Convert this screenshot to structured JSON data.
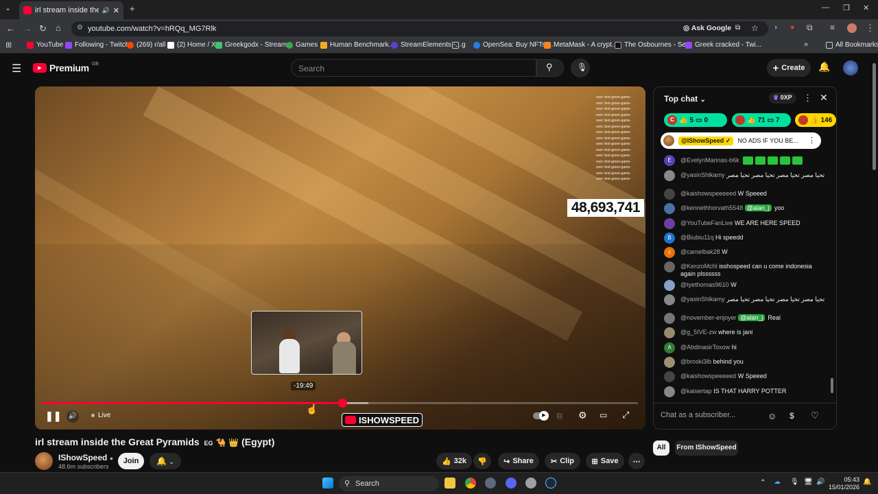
{
  "browser": {
    "tab_title": "irl stream inside the Great P",
    "url": "youtube.com/watch?v=hRQq_MG7Rlk",
    "ask_google": "Ask Google",
    "bookmarks": [
      "YouTube",
      "Following - Twitch",
      "(269) r/all",
      "(2) Home / X",
      "Greekgodx - Stream...",
      "Games",
      "Human Benchmark...",
      "StreamElements -...",
      "g",
      "OpenSea: Buy NFTs,...",
      "MetaMask - A crypt...",
      "The Osbournes - Se...",
      "Greek cracked - Twi..."
    ],
    "all_bookmarks": "All Bookmarks"
  },
  "header": {
    "logo_text": "Premium",
    "logo_region": "GB",
    "search_placeholder": "Search",
    "create_label": "Create"
  },
  "video": {
    "viewer_counter": "48,693,741",
    "preview_time": "-19:49",
    "live_label": "Live",
    "brand_text": "ISHOWSPEED",
    "overlay_lines": [
      "over::text-green-game-",
      "over::text-green-game-",
      "over::text-green-game-",
      "over::text-green-game-",
      "over::text-green-game-",
      "over::text-green-game-",
      "over::text-green-game-",
      "over::text-green-game-",
      "over::text-green-game-",
      "over::text-green-game-",
      "over::text-green-game-",
      "over::text-green-game-",
      "over::text-green-game-",
      "over::text-green-game-",
      "over::text-green-game-"
    ],
    "progress_played": 0.505,
    "progress_loaded": 0.548
  },
  "below": {
    "title": "irl stream inside the Great Pyramids",
    "title_flag": "EG",
    "title_suffix": "(Egypt)",
    "channel_name": "IShowSpeed",
    "subscribers": "48.6m subscribers",
    "join_label": "Join",
    "likes": "32k",
    "share_label": "Share",
    "clip_label": "Clip",
    "save_label": "Save"
  },
  "chat": {
    "title": "Top chat",
    "xp": "0XP",
    "polls": [
      {
        "letter": "C",
        "likes": "5",
        "comments": "0",
        "color": "#00e0a0"
      },
      {
        "letter": "",
        "likes": "71",
        "comments": "7",
        "color": "#00e0a0"
      },
      {
        "letter": "",
        "likes": "146",
        "comments": "",
        "color": "#ffd600"
      }
    ],
    "pinned_author": "@IShowSpeed",
    "pinned_text": "NO ADS IF YOU BE...",
    "messages": [
      {
        "author": "@EvelynMarinas-b6k",
        "text": "",
        "mention": "",
        "avatar": "E",
        "color": "#5c3fb5",
        "emotes": 5
      },
      {
        "author": "@yasinShlkamy",
        "text": "تحيا مصر تحيا مصر تحيا مصر تحيا مصر",
        "mention": "",
        "avatar": "",
        "color": "#888",
        "emotes": 0
      },
      {
        "author": "@kaishowspeeeeed",
        "text": "W Speeed",
        "mention": "",
        "avatar": "",
        "color": "#444",
        "emotes": 0
      },
      {
        "author": "@kennethhorvath5548",
        "text": "yoo",
        "mention": "@alan_j",
        "avatar": "",
        "color": "#4a6fa5",
        "emotes": 0
      },
      {
        "author": "@YouTubeFanLive",
        "text": "WE ARE HERE SPEED",
        "mention": "",
        "avatar": "",
        "color": "#6b3fa0",
        "emotes": 0
      },
      {
        "author": "@Biubiu11q",
        "text": "Hi speedd",
        "mention": "",
        "avatar": "B",
        "color": "#1976d2",
        "emotes": 0
      },
      {
        "author": "@camelbak28",
        "text": "W",
        "mention": "",
        "avatar": "c",
        "color": "#e8710a",
        "emotes": 0
      },
      {
        "author": "@KenzoMchl",
        "text": "isshospeed can u come indonesia again plssssss",
        "mention": "",
        "avatar": "",
        "color": "#666",
        "emotes": 0
      },
      {
        "author": "@tyethomas9610",
        "text": "W",
        "mention": "",
        "avatar": "",
        "color": "#8aa0c8",
        "emotes": 0
      },
      {
        "author": "@yasinShlkamy",
        "text": "تحيا مصر تحيا مصر تحيا مصر تحيا مصر",
        "mention": "",
        "avatar": "",
        "color": "#888",
        "emotes": 0
      },
      {
        "author": "@november-enjoyer",
        "text": "Real",
        "mention": "@alan_j",
        "avatar": "",
        "color": "#777",
        "emotes": 0
      },
      {
        "author": "@g_5IVE-zw",
        "text": "where is jani",
        "mention": "",
        "avatar": "",
        "color": "#9a8a70",
        "emotes": 0
      },
      {
        "author": "@AbdinasirToxow",
        "text": "hi",
        "mention": "",
        "avatar": "A",
        "color": "#2e7d32",
        "emotes": 0
      },
      {
        "author": "@broski3lb",
        "text": "behind you",
        "mention": "",
        "avatar": "",
        "color": "#a09070",
        "emotes": 0
      },
      {
        "author": "@kaishowspeeeeed",
        "text": "W Speeed",
        "mention": "",
        "avatar": "",
        "color": "#444",
        "emotes": 0
      },
      {
        "author": "@kaisertap",
        "text": "IS THAT HARRY POTTER",
        "mention": "",
        "avatar": "",
        "color": "#888",
        "emotes": 0
      }
    ],
    "input_placeholder": "Chat as a subscriber...",
    "chip_all": "All",
    "chip_from": "From IShowSpeed"
  },
  "taskbar": {
    "search_label": "Search",
    "time": "05:43",
    "date": "15/01/2026"
  }
}
